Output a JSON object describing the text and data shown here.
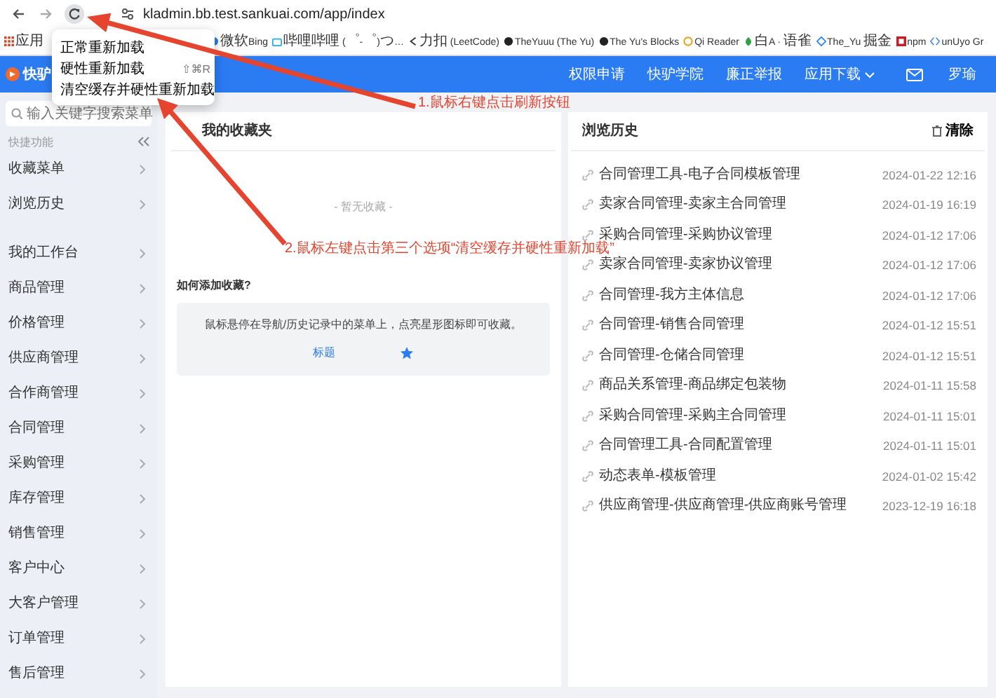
{
  "browser": {
    "url": "kladmin.bb.test.sankuai.com/app/index",
    "bookmarks": [
      "应用",
      "微软Bing",
      "哔哩哔哩 (゜-゜)つ…",
      "力扣 (LeetCode)",
      "TheYuuu (The Yu)",
      "The Yu's Blocks",
      "Qi Reader",
      "白A · 语雀",
      "The_Yu 掘金",
      "npm",
      "unUyo Gr"
    ]
  },
  "context_menu": {
    "items": [
      {
        "label": "正常重新加载"
      },
      {
        "label": "硬性重新加载",
        "shortcut": "⇧⌘R"
      },
      {
        "label": "清空缓存并硬性重新加载"
      }
    ]
  },
  "header": {
    "logo": "快驴",
    "nav": [
      {
        "label": "权限申请",
        "dropdown": false
      },
      {
        "label": "快驴学院",
        "dropdown": false
      },
      {
        "label": "廉正举报",
        "dropdown": false
      },
      {
        "label": "应用下载",
        "dropdown": true
      }
    ],
    "user": "罗瑜"
  },
  "sidebar": {
    "search_placeholder": "输入关键字搜索菜单",
    "section_label": "快捷功能",
    "quick_items": [
      "收藏菜单",
      "浏览历史"
    ],
    "items": [
      "我的工作台",
      "商品管理",
      "价格管理",
      "供应商管理",
      "合作商管理",
      "合同管理",
      "采购管理",
      "库存管理",
      "销售管理",
      "客户中心",
      "大客户管理",
      "订单管理",
      "售后管理"
    ]
  },
  "favorites": {
    "title": "我的收藏夹",
    "empty_text": "- 暂无收藏 -",
    "help_title": "如何添加收藏?",
    "help_text": "鼠标悬停在导航/历史记录中的菜单上，点亮星形图标即可收藏。",
    "help_example": "标题"
  },
  "history": {
    "title": "浏览历史",
    "clear_label": "清除",
    "rows": [
      {
        "title": "合同管理工具-电子合同模板管理",
        "time": "2024-01-22 12:16"
      },
      {
        "title": "卖家合同管理-卖家主合同管理",
        "time": "2024-01-19 16:19"
      },
      {
        "title": "采购合同管理-采购协议管理",
        "time": "2024-01-12 17:06"
      },
      {
        "title": "卖家合同管理-卖家协议管理",
        "time": "2024-01-12 17:06"
      },
      {
        "title": "合同管理-我方主体信息",
        "time": "2024-01-12 17:06"
      },
      {
        "title": "合同管理-销售合同管理",
        "time": "2024-01-12 15:51"
      },
      {
        "title": "合同管理-仓储合同管理",
        "time": "2024-01-12 15:51"
      },
      {
        "title": "商品关系管理-商品绑定包装物",
        "time": "2024-01-11 15:58"
      },
      {
        "title": "采购合同管理-采购主合同管理",
        "time": "2024-01-11 15:01"
      },
      {
        "title": "合同管理工具-合同配置管理",
        "time": "2024-01-11 15:01"
      },
      {
        "title": "动态表单-模板管理",
        "time": "2024-01-02 15:42"
      },
      {
        "title": "供应商管理-供应商管理-供应商账号管理",
        "time": "2023-12-19 16:18"
      }
    ]
  },
  "annotations": [
    "1.鼠标右键点击刷新按钮",
    "2.鼠标左键点击第三个选项“清空缓存并硬性重新加载”"
  ]
}
